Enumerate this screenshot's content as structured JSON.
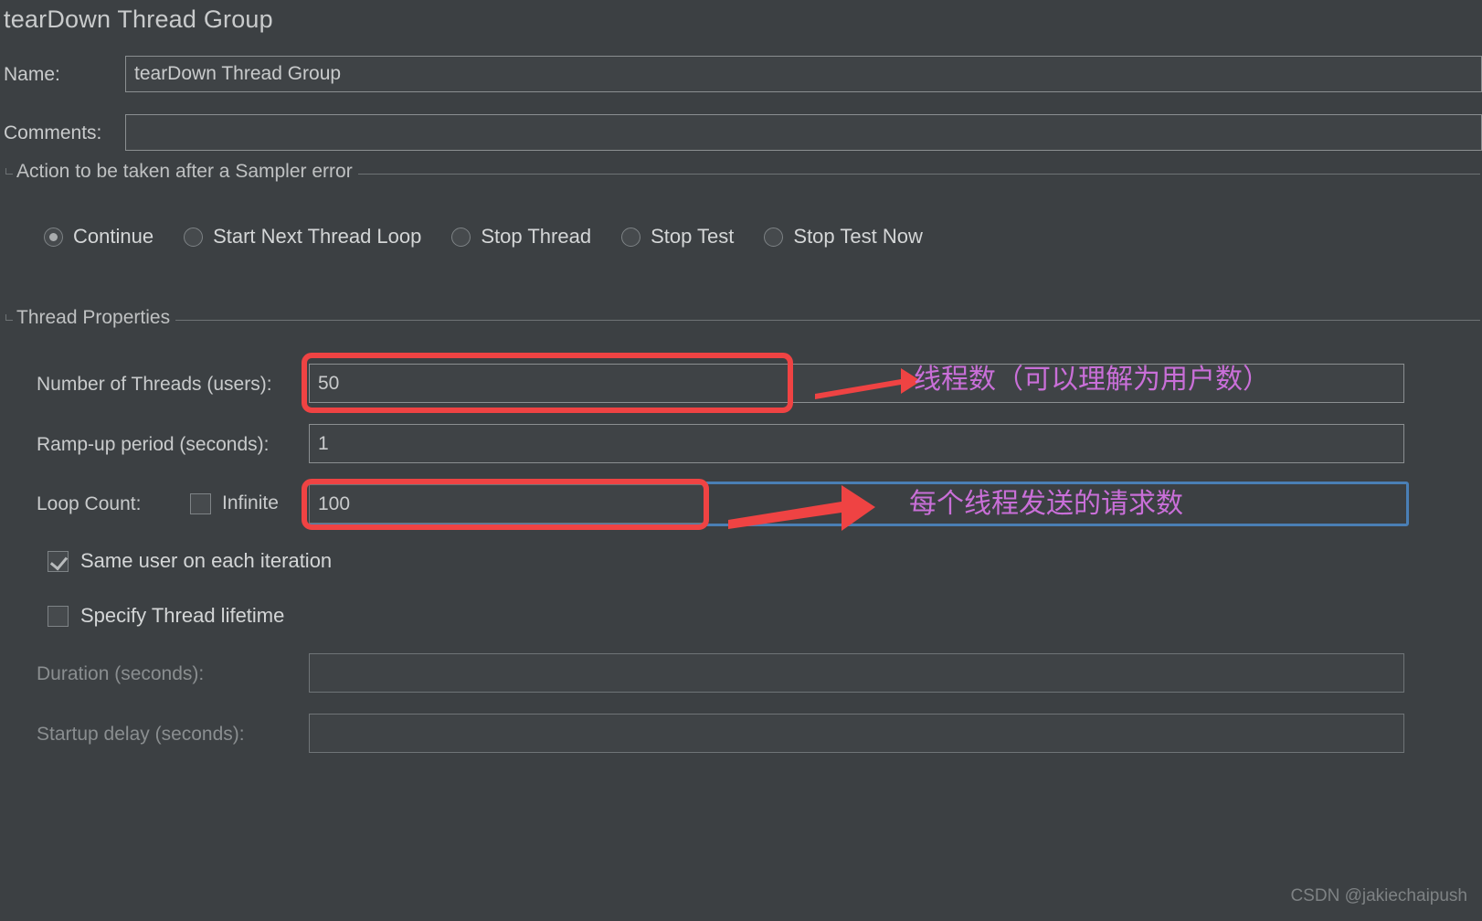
{
  "window": {
    "title": "tearDown Thread Group"
  },
  "form": {
    "name_label": "Name:",
    "name_value": "tearDown Thread Group",
    "comments_label": "Comments:",
    "comments_value": "",
    "comments_placeholder": ""
  },
  "sampler_error_group": {
    "legend": "Action to be taken after a Sampler error",
    "selected": "Continue",
    "options": [
      {
        "label": "Continue",
        "selected": true
      },
      {
        "label": "Start Next Thread Loop",
        "selected": false
      },
      {
        "label": "Stop Thread",
        "selected": false
      },
      {
        "label": "Stop Test",
        "selected": false
      },
      {
        "label": "Stop Test Now",
        "selected": false
      }
    ]
  },
  "thread_properties": {
    "legend": "Thread Properties",
    "number_of_threads": {
      "label": "Number of Threads (users):",
      "value": "50",
      "enabled": true,
      "highlighted": true
    },
    "ramp_up": {
      "label": "Ramp-up period (seconds):",
      "value": "1",
      "enabled": true,
      "highlighted": false
    },
    "loop_count": {
      "label": "Loop Count:",
      "value": "100",
      "enabled": true,
      "highlighted": true,
      "focused": true,
      "infinite_label": "Infinite",
      "infinite_checked": false
    },
    "same_user": {
      "label": "Same user on each iteration",
      "checked": true
    },
    "specify_thread_lifetime": {
      "label": "Specify Thread lifetime",
      "checked": false
    },
    "duration": {
      "label": "Duration (seconds):",
      "value": "",
      "enabled": false
    },
    "startup_delay": {
      "label": "Startup delay (seconds):",
      "value": "",
      "enabled": false
    }
  },
  "annotations": [
    {
      "text": "线程数（可以理解为用户数）",
      "color": "#c96fd8",
      "target": "number_of_threads",
      "arrow_color": "#ef4343"
    },
    {
      "text": "每个线程发送的请求数",
      "color": "#c96fd8",
      "target": "loop_count",
      "arrow_color": "#ef4343"
    }
  ],
  "colors": {
    "background": "#3c4043",
    "text": "#c9cbcc",
    "text_disabled": "#8a8e90",
    "field_border": "#8b8f91",
    "highlight_red": "#ef4343",
    "focus_blue": "#4a7fb5",
    "annotation_purple": "#c96fd8"
  },
  "watermark": {
    "text": "CSDN @jakiechaipush"
  }
}
